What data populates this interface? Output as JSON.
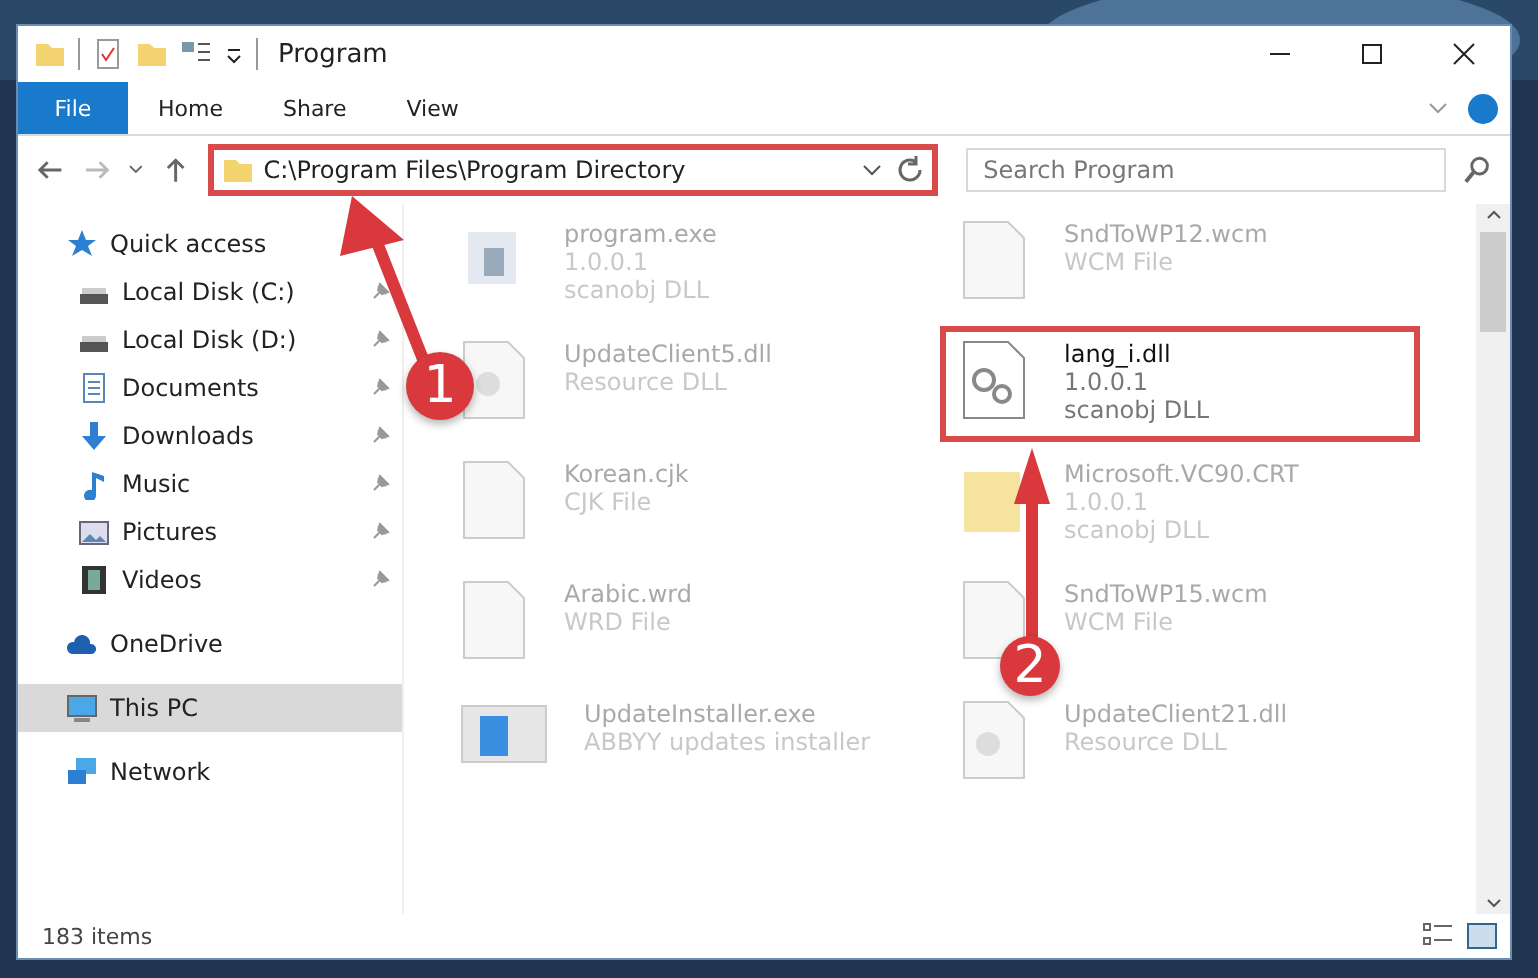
{
  "window": {
    "title": "Program"
  },
  "ribbon_tabs": [
    {
      "label": "File",
      "selected": true
    },
    {
      "label": "Home",
      "selected": false
    },
    {
      "label": "Share",
      "selected": false
    },
    {
      "label": "View",
      "selected": false
    }
  ],
  "address": {
    "path": "C:\\Program Files\\Program Directory",
    "highlighted": true
  },
  "search": {
    "placeholder": "Search Program"
  },
  "sidebar": [
    {
      "label": "Quick access",
      "pinned": false,
      "selected": false
    },
    {
      "label": "Local Disk (C:)",
      "pinned": true,
      "selected": false
    },
    {
      "label": "Local Disk (D:)",
      "pinned": true,
      "selected": false
    },
    {
      "label": "Documents",
      "pinned": true,
      "selected": false
    },
    {
      "label": "Downloads",
      "pinned": true,
      "selected": false
    },
    {
      "label": "Music",
      "pinned": true,
      "selected": false
    },
    {
      "label": "Pictures",
      "pinned": true,
      "selected": false
    },
    {
      "label": "Videos",
      "pinned": true,
      "selected": false
    },
    {
      "label": "OneDrive",
      "pinned": false,
      "selected": false
    },
    {
      "label": "This PC",
      "pinned": false,
      "selected": true
    },
    {
      "label": "Network",
      "pinned": false,
      "selected": false
    }
  ],
  "files": [
    {
      "name": "program.exe",
      "details": [
        "1.0.0.1",
        "scanobj DLL"
      ],
      "highlighted": false
    },
    {
      "name": "SndToWP12.wcm",
      "details": [
        "WCM File"
      ],
      "highlighted": false
    },
    {
      "name": "UpdateClient5.dll",
      "details": [
        "Resource DLL"
      ],
      "highlighted": false
    },
    {
      "name": "lang_i.dll",
      "details": [
        "1.0.0.1",
        "scanobj DLL"
      ],
      "highlighted": true
    },
    {
      "name": "Korean.cjk",
      "details": [
        "CJK File"
      ],
      "highlighted": false
    },
    {
      "name": "Microsoft.VC90.CRT",
      "details": [
        "1.0.0.1",
        "scanobj DLL"
      ],
      "highlighted": false
    },
    {
      "name": "Arabic.wrd",
      "details": [
        "WRD File"
      ],
      "highlighted": false
    },
    {
      "name": "SndToWP15.wcm",
      "details": [
        "WCM File"
      ],
      "highlighted": false
    },
    {
      "name": "UpdateInstaller.exe",
      "details": [
        "ABBYY updates installer"
      ],
      "highlighted": false
    },
    {
      "name": "UpdateClient21.dll",
      "details": [
        "Resource DLL"
      ],
      "highlighted": false
    }
  ],
  "status": {
    "count": "183 items"
  },
  "callouts": [
    {
      "number": "1"
    },
    {
      "number": "2"
    }
  ]
}
